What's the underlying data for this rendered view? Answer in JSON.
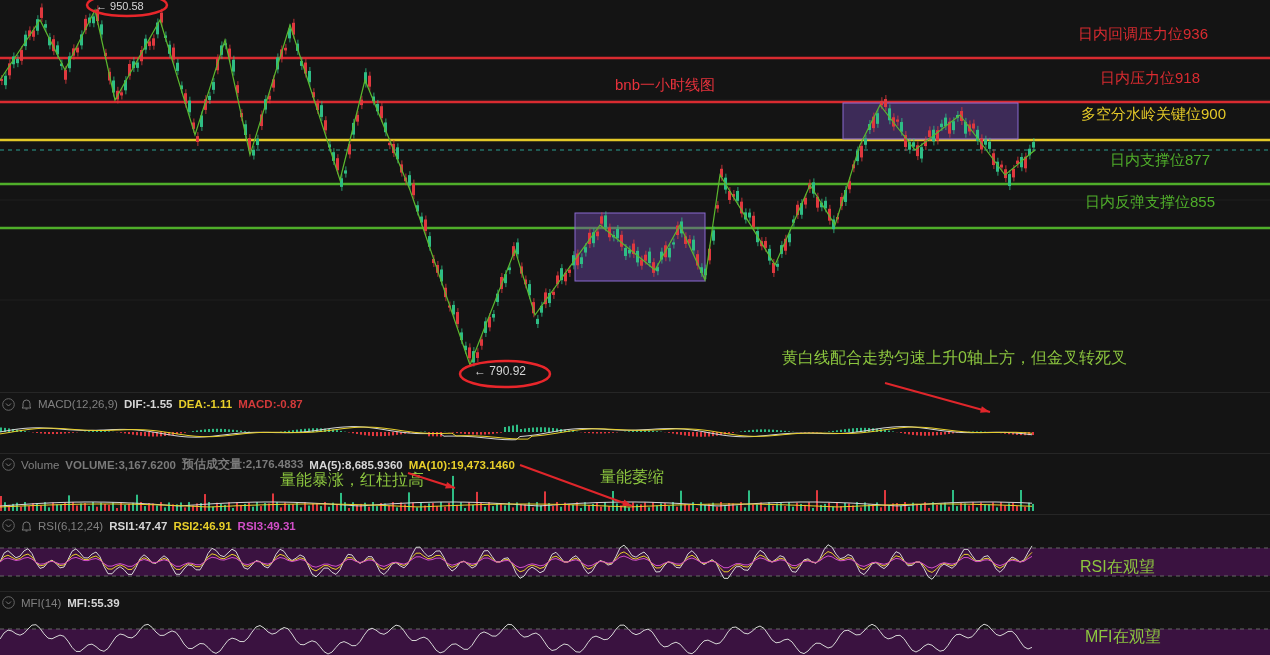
{
  "chart": {
    "title": "bnb一小时线图",
    "high_marker": "← 950.58",
    "low_marker": "← 790.92",
    "levels": [
      {
        "label": "日内回调压力位936",
        "kind": "resistance"
      },
      {
        "label": "日内压力位918",
        "kind": "resistance"
      },
      {
        "label": "多空分水岭关键位900",
        "kind": "pivot"
      },
      {
        "label": "日内支撑位877",
        "kind": "support"
      },
      {
        "label": "日内反弹支撑位855",
        "kind": "support"
      }
    ],
    "note": "黄白线配合走势匀速上升0轴上方，但金叉转死叉"
  },
  "indicators": [
    {
      "kind": "macd",
      "name": "MACD(12,26,9)",
      "bell": true,
      "values": [
        {
          "text": "DIF:-1.55",
          "color": "#d6d6d6"
        },
        {
          "text": "DEA:-1.11",
          "color": "#e8cf2a"
        },
        {
          "text": "MACD:-0.87",
          "color": "#d23a3a"
        }
      ]
    },
    {
      "kind": "volume",
      "name": "Volume",
      "bell": false,
      "values": [
        {
          "text": "VOLUME:3,167.6200",
          "color": "#7a7a7a"
        },
        {
          "text": "预估成交量:2,176.4833",
          "color": "#7a7a7a"
        },
        {
          "text": "MA(5):8,685.9360",
          "color": "#d6d6d6"
        },
        {
          "text": "MA(10):19,473.1460",
          "color": "#e8cf2a"
        }
      ],
      "notes": [
        "量能暴涨，红柱拉高",
        "量能萎缩"
      ]
    },
    {
      "kind": "rsi",
      "name": "RSI(6,12,24)",
      "bell": true,
      "values": [
        {
          "text": "RSI1:47.47",
          "color": "#d6d6d6"
        },
        {
          "text": "RSI2:46.91",
          "color": "#e8cf2a"
        },
        {
          "text": "RSI3:49.31",
          "color": "#d14fc8"
        }
      ],
      "notes": [
        "RSI在观望"
      ]
    },
    {
      "kind": "mfi",
      "name": "MFI(14)",
      "bell": false,
      "values": [
        {
          "text": "MFI:55.39",
          "color": "#d6d6d6"
        }
      ],
      "notes": [
        "MFI在观望"
      ]
    }
  ]
}
